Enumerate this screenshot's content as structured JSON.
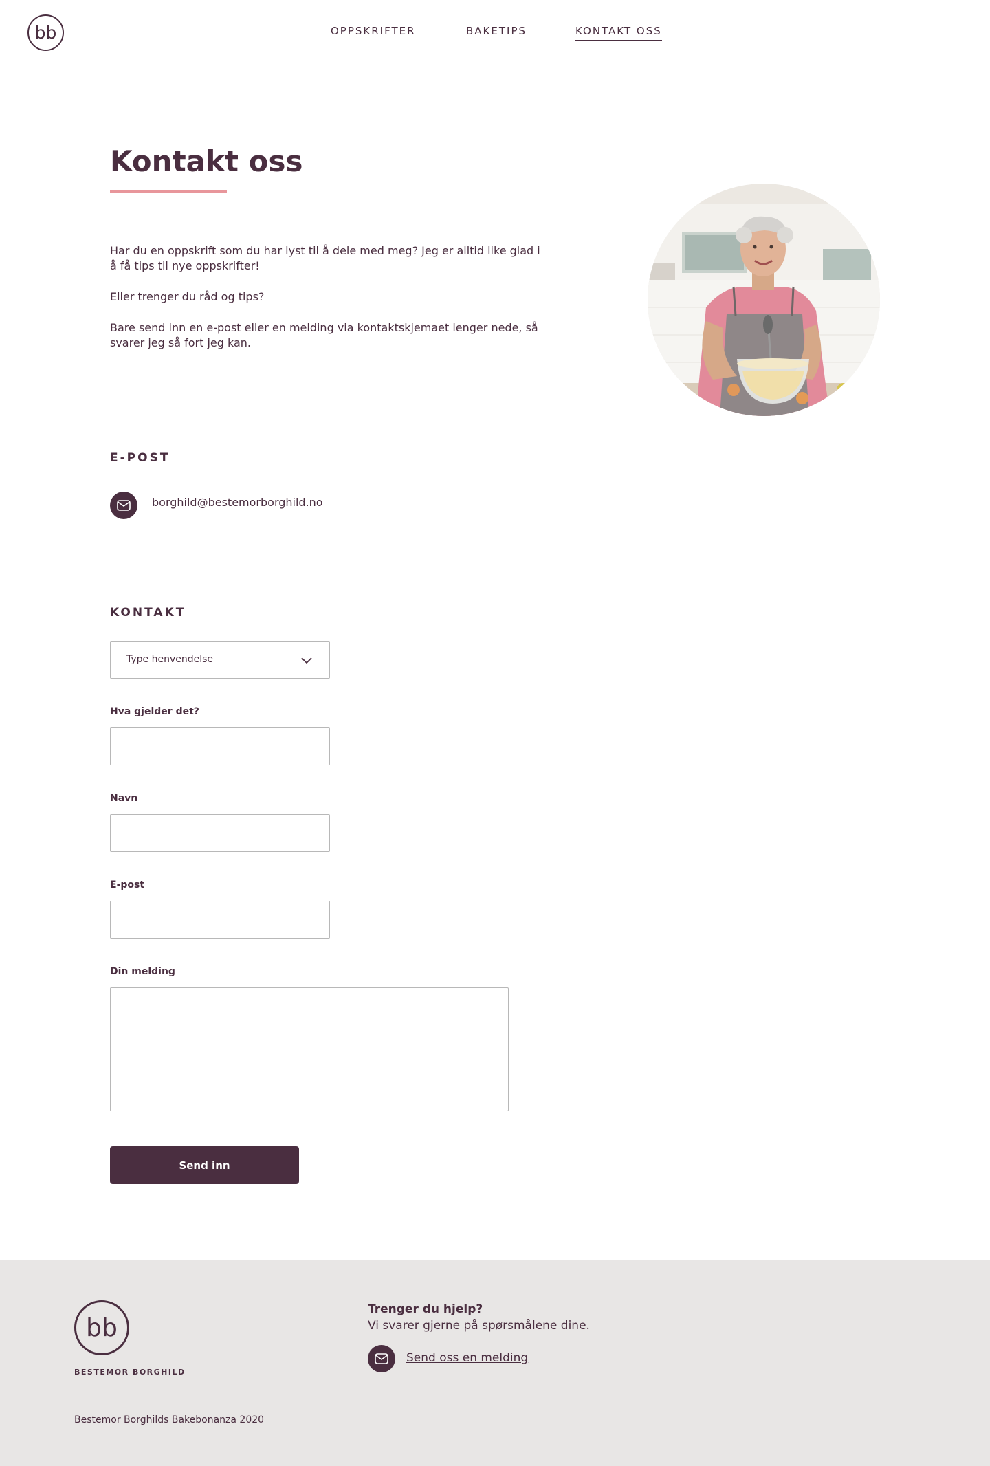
{
  "header": {
    "logo_text": "bb",
    "nav": [
      {
        "label": "OPPSKRIFTER"
      },
      {
        "label": "BAKETIPS"
      },
      {
        "label": "KONTAKT OSS"
      }
    ]
  },
  "hero": {
    "title": "Kontakt oss",
    "paragraphs": [
      "Har du en oppskrift som du har lyst til å dele med meg? Jeg er alltid like glad i å få tips til nye oppskrifter!",
      "Eller trenger du råd og tips?",
      "Bare send inn en e-post eller en melding via kontaktskjemaet lenger nede, så svarer jeg så fort jeg kan."
    ]
  },
  "email_section": {
    "heading": "E-POST",
    "address": "borghild@bestemorborghild.no"
  },
  "contact_section": {
    "heading": "KONTAKT",
    "select_placeholder": "Type henvendelse",
    "field_subject_label": "Hva gjelder det?",
    "field_name_label": "Navn",
    "field_email_label": "E-post",
    "field_message_label": "Din melding",
    "submit_label": "Send inn"
  },
  "footer": {
    "logo_text": "bb",
    "brand_name": "BESTEMOR BORGHILD",
    "help_title": "Trenger du hjelp?",
    "help_subtitle": "Vi svarer gjerne på spørsmålene dine.",
    "help_link": "Send oss en melding",
    "copyright": "Bestemor Borghilds Bakebonanza 2020"
  },
  "colors": {
    "primary": "#4a2e40",
    "accent": "#e8969b",
    "footer_bg": "#e8e6e5"
  },
  "icons": {
    "mail": "envelope-icon",
    "select": "chevron-down-icon"
  }
}
